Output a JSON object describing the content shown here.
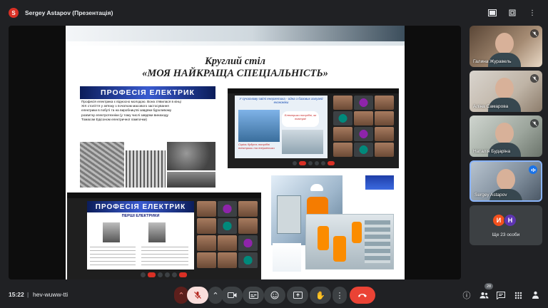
{
  "top": {
    "presenter_initial": "S",
    "title": "Sergey Astapov (Презентація)"
  },
  "slide": {
    "title_line1": "Круглий стіл",
    "title_line2": "«МОЯ НАЙКРАЩА СПЕЦІАЛЬНІСТЬ»",
    "card_a_banner": "ПРОФЕСІЯ ЕЛЕКТРИК",
    "card_a_text": "Професія електрика є відносно молодою. Вона з'явилася в кінці XIX століття у зв'язку з початком масового застосування електрики в побуті та на виробництві завдяки бурхливому розвитку електротехніки (у тому числі завдяки винаходу Томасом Едісоном електричної лампочки)",
    "card_b_slide_title": "У сучасному світі енергетика - одна з базових галузей економіки",
    "card_b_bubble": "Електрики потрібні, як повітря!",
    "card_b_caption": "Скрізь будуть потрібні електрики та енергетики",
    "card_c_banner": "ПРОФЕСІЯ ЕЛЕКТРИК",
    "card_c_sub": "ПЕРШІ ЕЛЕКТРИКИ"
  },
  "participants": [
    {
      "name": "Галина Журавель",
      "muted": true
    },
    {
      "name": "Аліна Самарова",
      "muted": true
    },
    {
      "name": "Наталія Бударіна",
      "muted": true
    },
    {
      "name": "Sergey Astapov",
      "muted": false
    }
  ],
  "more": {
    "initial1": "И",
    "initial2": "Н",
    "label": "Ще 23 особи"
  },
  "bottom": {
    "time": "15:22",
    "separator": "|",
    "meeting_code": "hev-wuww-tti",
    "people_count": "28"
  },
  "icons": {
    "mute": "mic-off-icon",
    "camera": "camera-icon",
    "captions": "captions-icon",
    "emoji": "emoji-icon",
    "present": "present-icon",
    "hand": "raise-hand-icon",
    "more": "more-icon",
    "leave": "leave-call-icon"
  },
  "colors": {
    "background": "#202124",
    "leave": "#ea4335",
    "mic_off": "#f9dedc",
    "accent": "#8ab4f8"
  }
}
